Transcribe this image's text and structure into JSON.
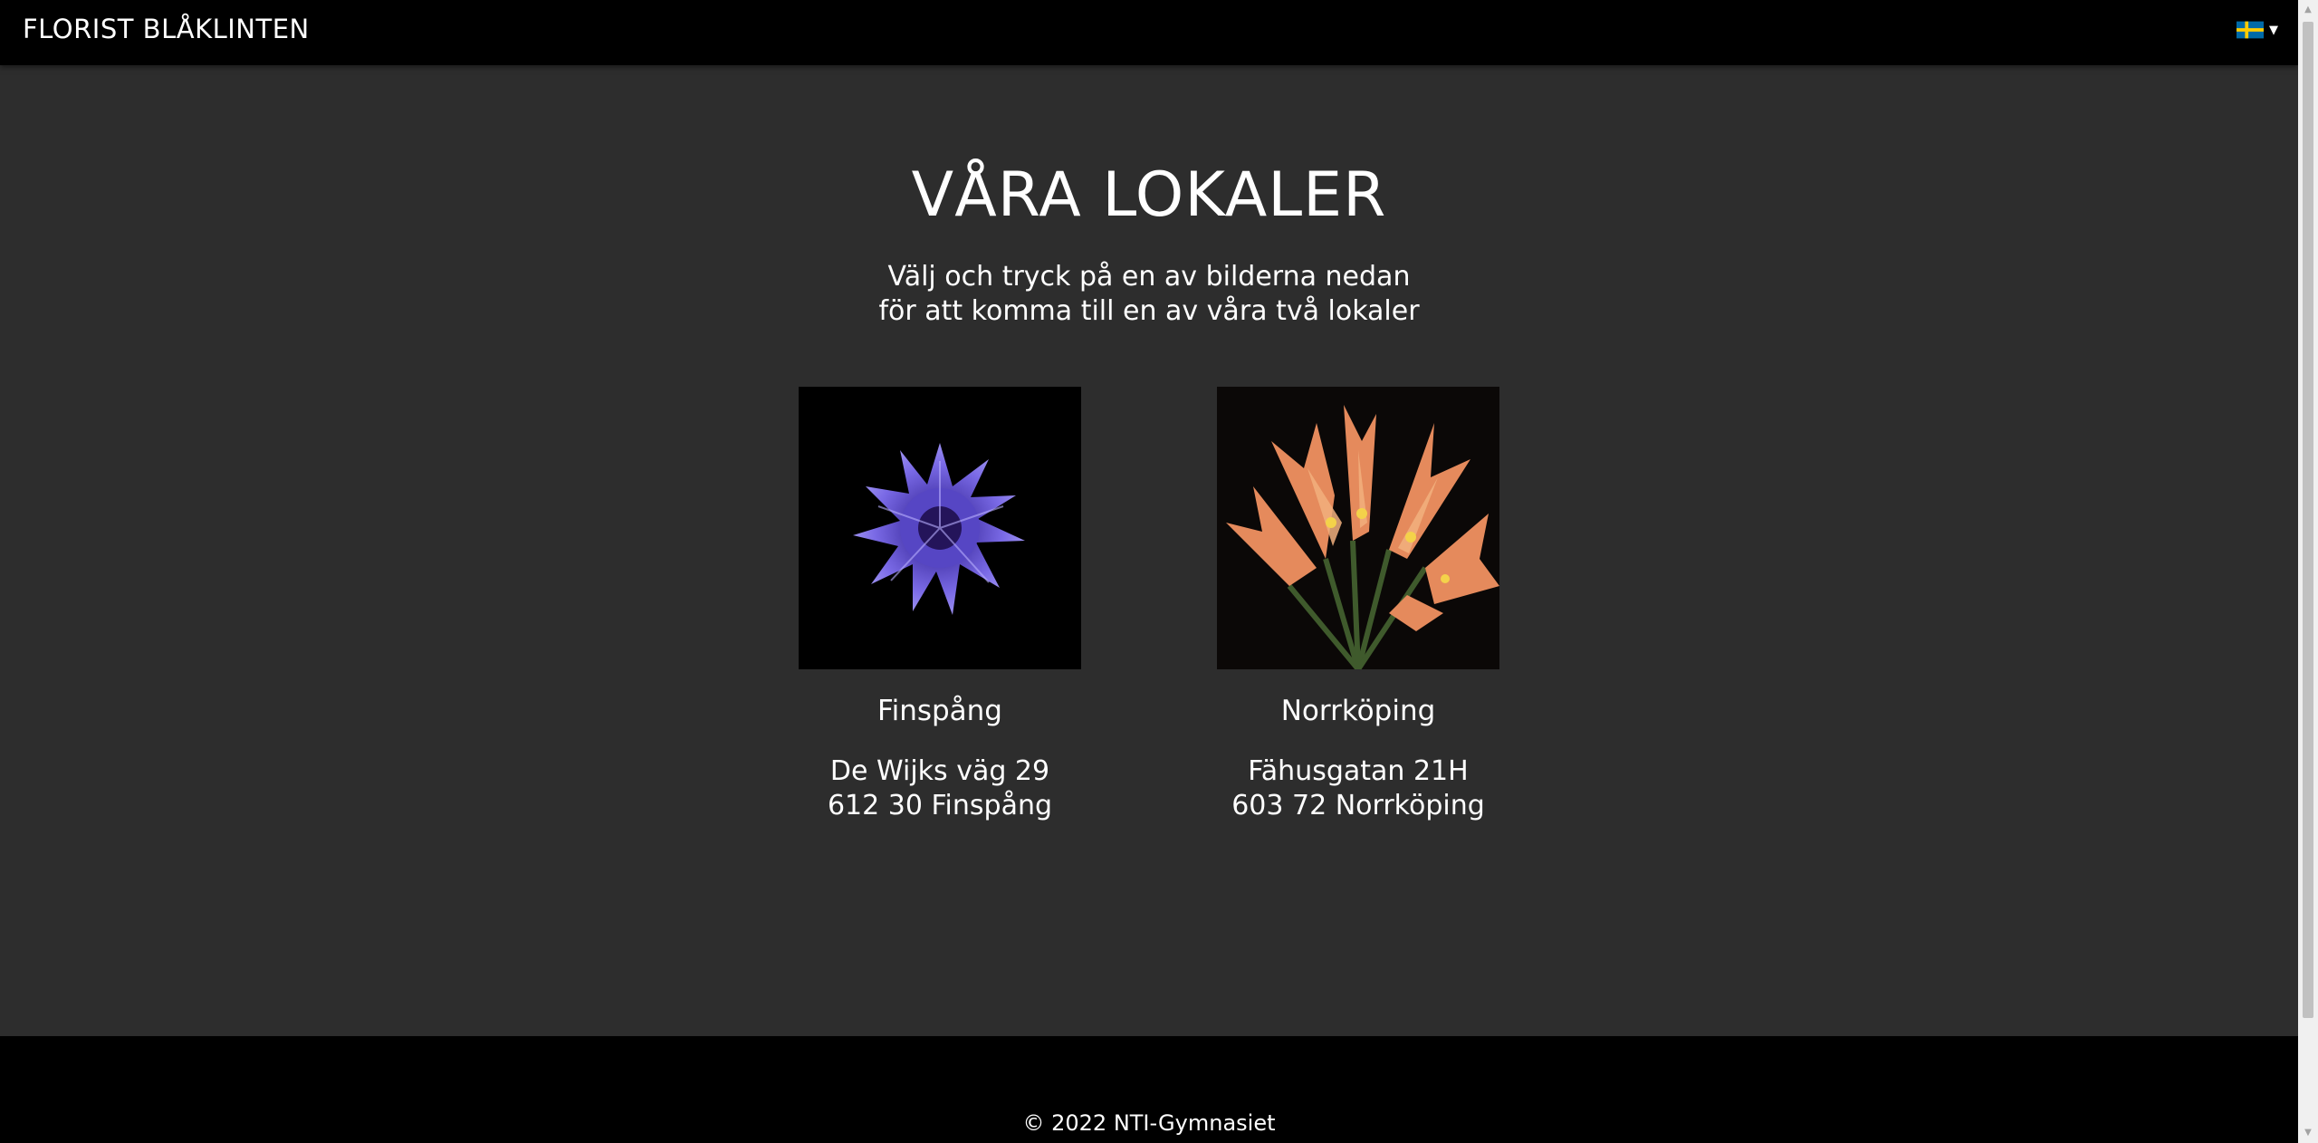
{
  "header": {
    "brand": "FLORIST BLÅKLINTEN",
    "language_icon": "swedish-flag-icon"
  },
  "main": {
    "title": "VÅRA LOKALER",
    "intro_line1": "Välj och tryck på en av bilderna nedan",
    "intro_line2": "för att komma till en av våra två lokaler"
  },
  "locations": [
    {
      "name": "Finspång",
      "street": "De Wijks väg 29",
      "postal": "612 30 Finspång",
      "image": "blue-cornflower"
    },
    {
      "name": "Norrköping",
      "street": "Fähusgatan 21H",
      "postal": "603 72 Norrköping",
      "image": "orange-clivia"
    }
  ],
  "footer": {
    "copyright": "© 2022 NTI-Gymnasiet"
  },
  "colors": {
    "page_bg": "#2d2d2d",
    "bar_bg": "#000000",
    "text": "#ffffff"
  }
}
